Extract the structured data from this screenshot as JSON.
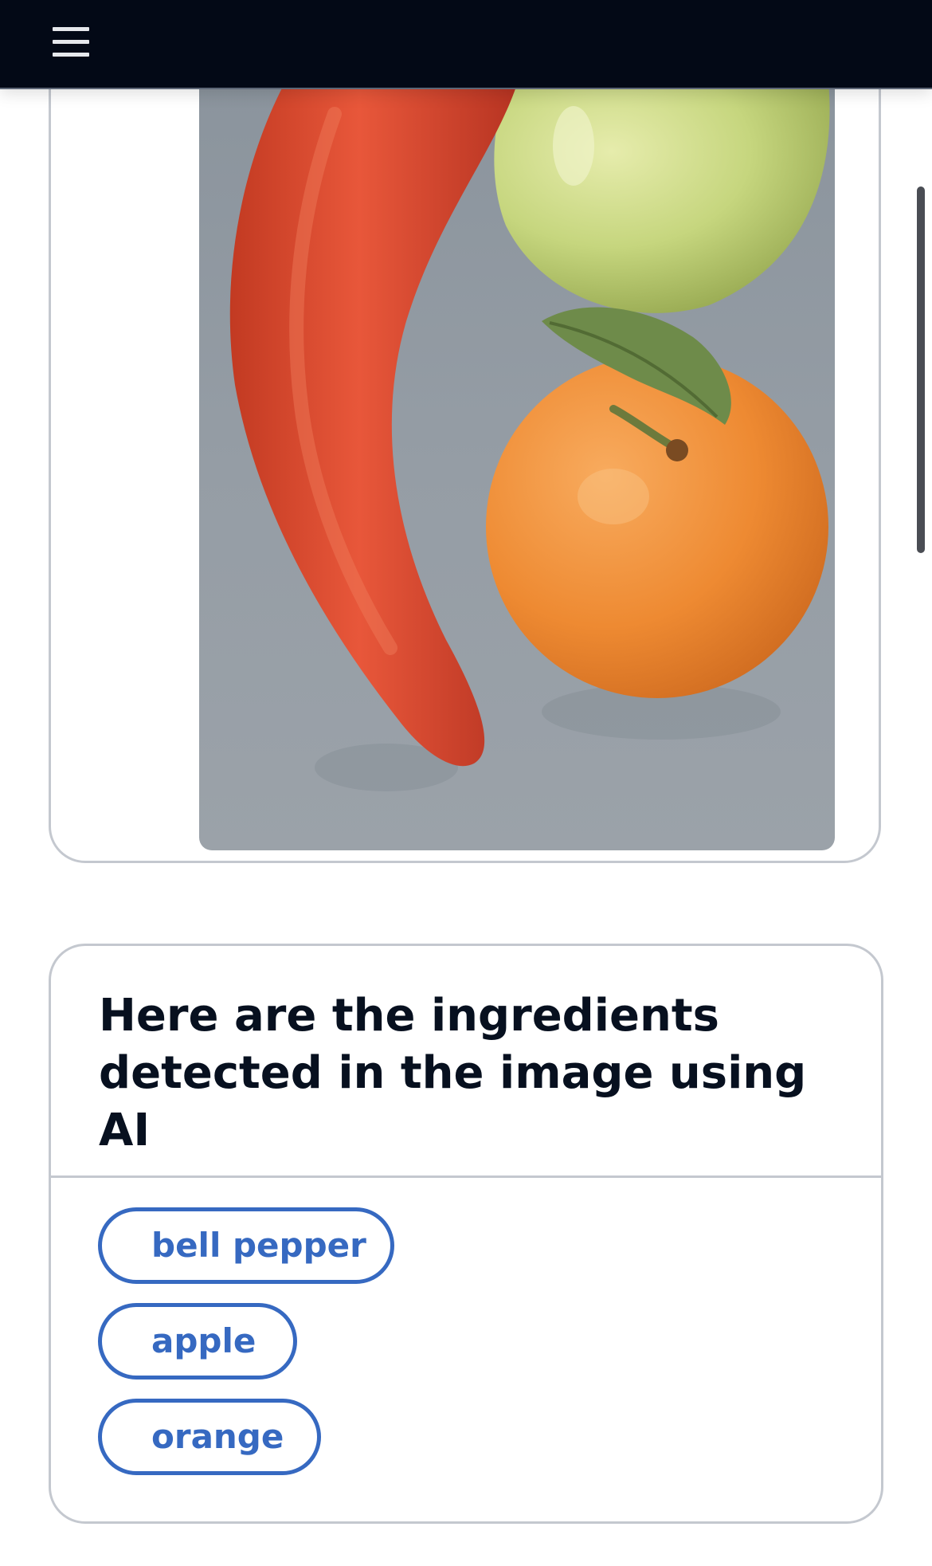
{
  "header": {
    "menu_icon": "hamburger-menu-icon",
    "background": "#030916"
  },
  "photo": {
    "subject": "bell pepper, apple and orange on a grey surface"
  },
  "ingredients": {
    "title": "Here are the ingredients detected in the image using AI",
    "accent_color": "#3669c1",
    "items": [
      {
        "label": "bell pepper"
      },
      {
        "label": "apple"
      },
      {
        "label": "orange"
      }
    ]
  }
}
